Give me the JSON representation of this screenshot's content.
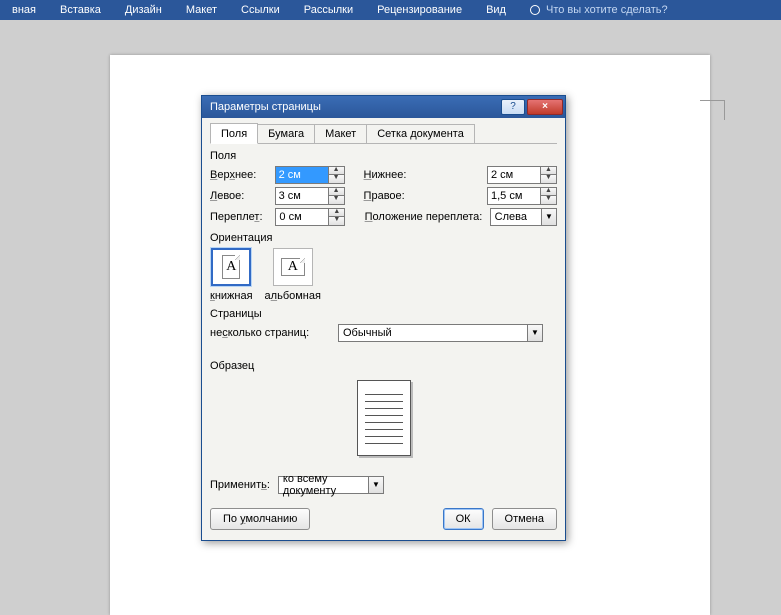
{
  "ribbon": {
    "tabs": [
      "вная",
      "Вставка",
      "Дизайн",
      "Макет",
      "Ссылки",
      "Рассылки",
      "Рецензирование",
      "Вид"
    ],
    "help_prompt": "Что вы хотите сделать?"
  },
  "dialog": {
    "title": "Параметры страницы",
    "help_btn": "?",
    "close_btn": "×",
    "tabs": {
      "fields": "Поля",
      "paper": "Бумага",
      "layout": "Макет",
      "grid": "Сетка документа"
    },
    "section_fields": "Поля",
    "labels": {
      "top": "Верхнее:",
      "bottom": "Нижнее:",
      "left": "Левое:",
      "right": "Правое:",
      "gutter": "Переплет:",
      "gutter_pos": "Положение переплета:"
    },
    "values": {
      "top": "2 см",
      "bottom": "2 см",
      "left": "3 см",
      "right": "1,5 см",
      "gutter": "0 см",
      "gutter_pos": "Слева"
    },
    "section_orient": "Ориентация",
    "orient": {
      "portrait": "книжная",
      "landscape": "альбомная"
    },
    "section_pages": "Страницы",
    "pages_label": "несколько страниц:",
    "pages_value": "Обычный",
    "section_sample": "Образец",
    "apply_label": "Применить:",
    "apply_value": "ко всему документу",
    "buttons": {
      "default": "По умолчанию",
      "ok": "ОК",
      "cancel": "Отмена"
    }
  }
}
